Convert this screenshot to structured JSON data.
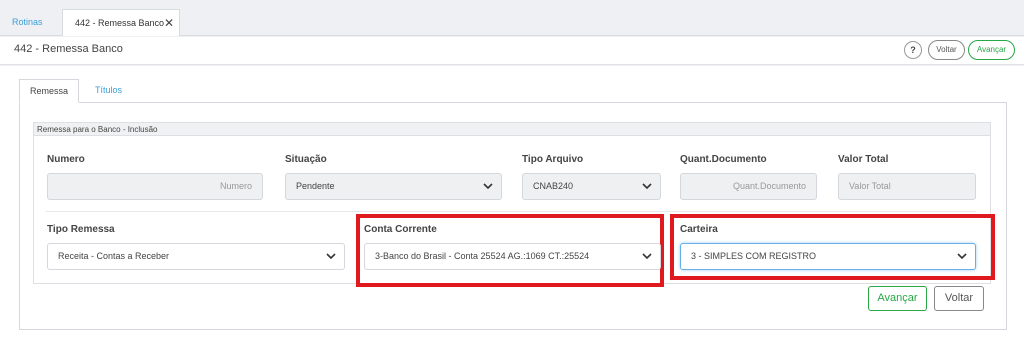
{
  "tabs": {
    "rotinas": "Rotinas",
    "active": "442 - Remessa Banco",
    "close": "✕"
  },
  "header": {
    "title": "442 - Remessa Banco",
    "help": "?",
    "voltar": "Voltar",
    "avancar": "Avançar"
  },
  "subtabs": {
    "remessa": "Remessa",
    "titulos": "Títulos"
  },
  "section_title": "Remessa para o Banco - Inclusão",
  "fields": {
    "numero": {
      "label": "Numero",
      "placeholder": "Numero"
    },
    "situacao": {
      "label": "Situação",
      "value": "Pendente"
    },
    "tipo_arquivo": {
      "label": "Tipo Arquivo",
      "value": "CNAB240"
    },
    "quant_documento": {
      "label": "Quant.Documento",
      "placeholder": "Quant.Documento"
    },
    "valor_total": {
      "label": "Valor Total",
      "placeholder": "Valor Total"
    },
    "tipo_remessa": {
      "label": "Tipo Remessa",
      "value": "Receita - Contas a Receber"
    },
    "conta_corrente": {
      "label": "Conta Corrente",
      "value": "3-Banco do Brasil - Conta 25524 AG.:1069 CT.:25524"
    },
    "carteira": {
      "label": "Carteira",
      "value": "3 - SIMPLES COM REGISTRO"
    }
  },
  "footer": {
    "avancar": "Avançar",
    "voltar": "Voltar"
  },
  "colors": {
    "accent_blue": "#3a9fd6",
    "success_green": "#28a745",
    "highlight_red": "#e0191f"
  }
}
